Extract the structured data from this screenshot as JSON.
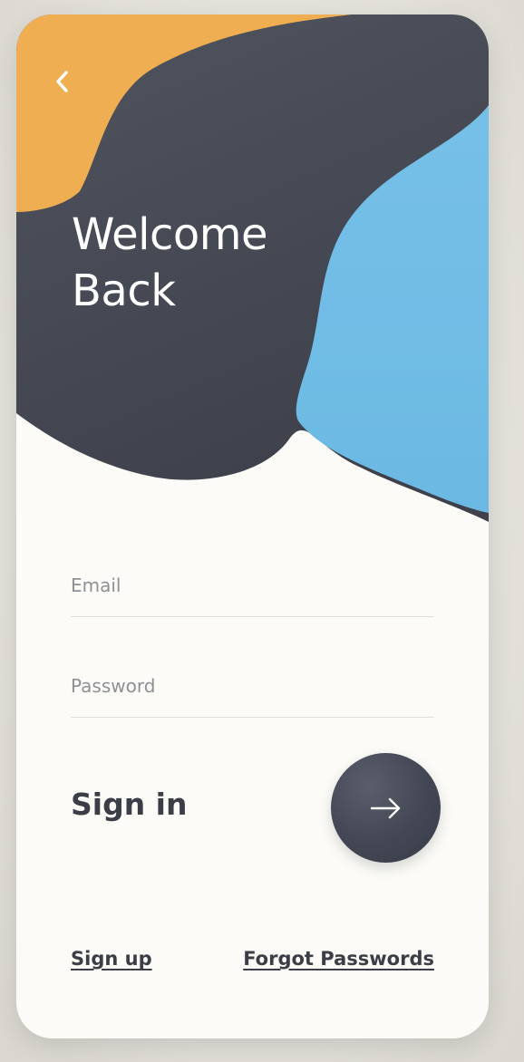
{
  "header": {
    "title_line1": "Welcome",
    "title_line2": "Back",
    "back_icon": "chevron-left-icon"
  },
  "form": {
    "email_placeholder": "Email",
    "email_value": "",
    "password_placeholder": "Password",
    "password_value": ""
  },
  "signin": {
    "label": "Sign in",
    "button_icon": "arrow-right-icon"
  },
  "footer": {
    "signup_label": "Sign up",
    "forgot_label": "Forgot Passwords"
  },
  "colors": {
    "dark": "#434754",
    "orange": "#f0ae52",
    "blue": "#6ebde6",
    "card": "#fcfbf7"
  }
}
